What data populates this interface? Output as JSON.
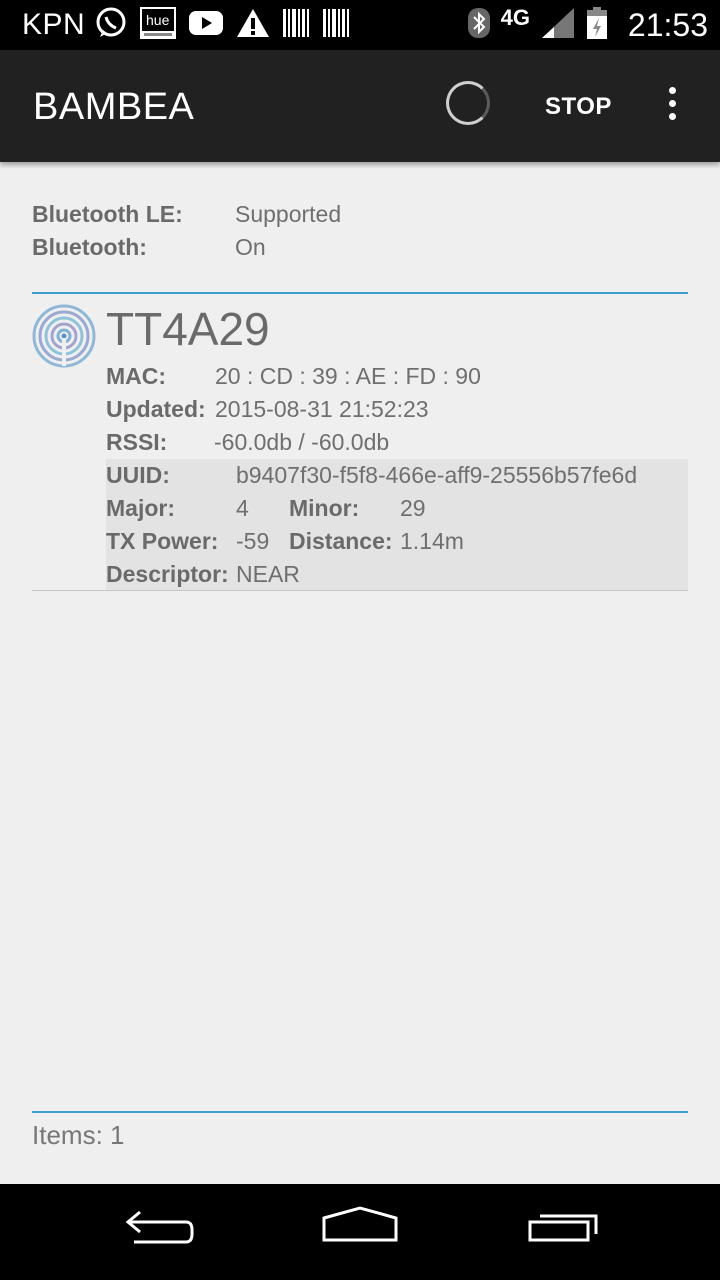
{
  "status_bar": {
    "carrier": "KPN",
    "network": "4G",
    "time": "21:53",
    "icons": [
      "whatsapp-icon",
      "hue-icon",
      "youtube-icon",
      "warning-icon",
      "barcode-icon",
      "barcode-icon",
      "bluetooth-icon",
      "signal-icon",
      "battery-icon"
    ]
  },
  "app_bar": {
    "title": "BAMBEA",
    "stop_label": "STOP"
  },
  "bluetooth": {
    "le_label": "Bluetooth LE:",
    "le_value": "Supported",
    "bt_label": "Bluetooth:",
    "bt_value": "On"
  },
  "device": {
    "name": "TT4A29",
    "mac_label": "MAC:",
    "mac_value": "20 : CD : 39 : AE : FD : 90",
    "updated_label": "Updated:",
    "updated_value": "2015-08-31 21:52:23",
    "rssi_label": "RSSI:",
    "rssi_value": "-60.0db / -60.0db",
    "uuid_label": "UUID:",
    "uuid_value": "b9407f30-f5f8-466e-aff9-25556b57fe6d",
    "major_label": "Major:",
    "major_value": "4",
    "minor_label": "Minor:",
    "minor_value": "29",
    "tx_label": "TX Power:",
    "tx_value": "-59",
    "distance_label": "Distance:",
    "distance_value": "1.14m",
    "descriptor_label": "Descriptor:",
    "descriptor_value": "NEAR"
  },
  "footer": {
    "items_count": "Items: 1"
  },
  "colors": {
    "accent": "#3aa0d0",
    "appbar": "#212121"
  }
}
